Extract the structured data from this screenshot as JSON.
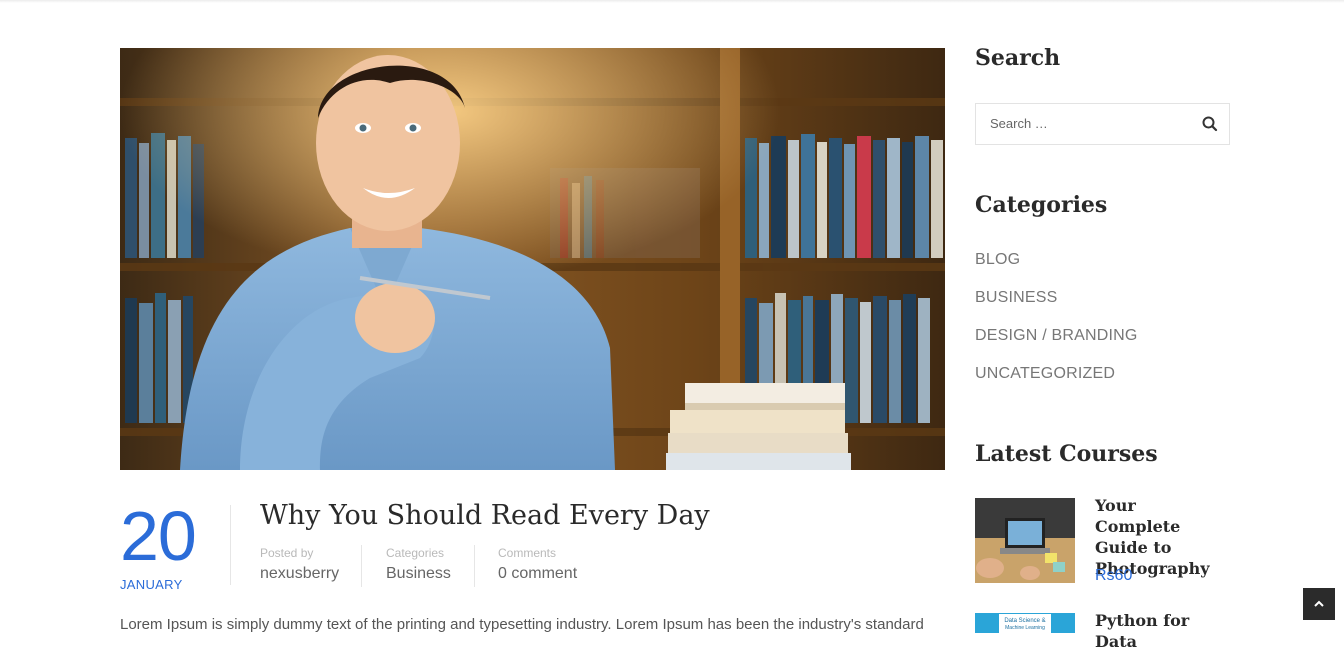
{
  "post": {
    "date_day": "20",
    "date_month": "JANUARY",
    "title": "Why You Should Read Every Day",
    "posted_by_label": "Posted by",
    "author": "nexusberry",
    "categories_label": "Categories",
    "category": "Business",
    "comments_label": "Comments",
    "comments": "0 comment",
    "excerpt": "Lorem Ipsum is simply dummy text of the printing and typesetting industry. Lorem Ipsum has been the industry's standard"
  },
  "sidebar": {
    "search_title": "Search",
    "search_placeholder": "Search …",
    "categories_title": "Categories",
    "categories": [
      "BLOG",
      "BUSINESS",
      "DESIGN / BRANDING",
      "UNCATEGORIZED"
    ],
    "courses_title": "Latest Courses",
    "courses": [
      {
        "title": "Your Complete Guide to Photography",
        "price": "Rs60"
      },
      {
        "title": "Python for Data",
        "thumb_text_1": "Data Science &",
        "thumb_text_2": "Machine Learning"
      }
    ]
  },
  "icons": {
    "search": "search-icon",
    "back_to_top": "chevron-up-icon"
  },
  "colors": {
    "accent": "#2b6cd8",
    "heading": "#2a2a2a",
    "muted": "#777777"
  }
}
